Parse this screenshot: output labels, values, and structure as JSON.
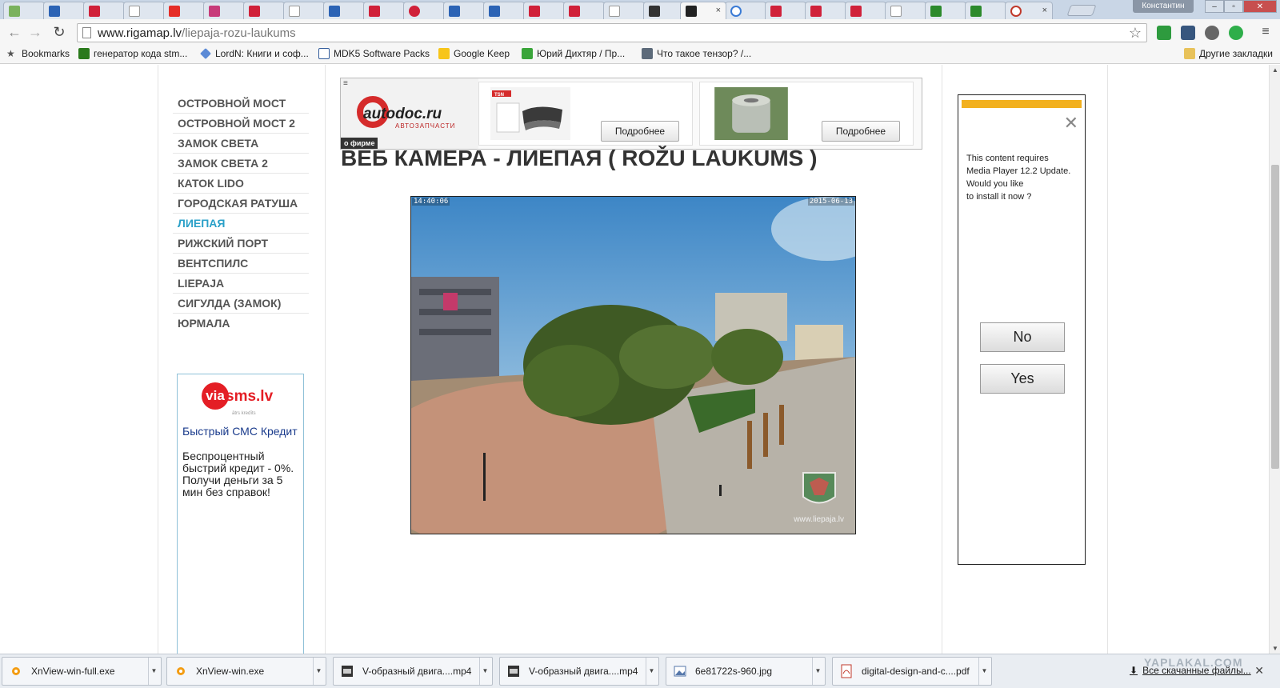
{
  "window": {
    "profile": "Константин",
    "tab_labels": [
      "",
      "",
      "",
      "",
      "",
      "",
      "",
      "",
      "",
      "",
      "",
      "",
      "",
      "",
      "",
      "",
      "",
      "",
      "",
      "",
      "",
      "",
      "",
      "",
      ""
    ],
    "active_tab_close": "×"
  },
  "toolbar": {
    "url_host": "www.rigamap.lv",
    "url_path": "/liepaja-rozu-laukums"
  },
  "bookmarks": [
    {
      "label": "Bookmarks",
      "icon": "star-icon"
    },
    {
      "label": "генератор кода stm...",
      "icon": "chip-icon"
    },
    {
      "label": "LordN: Книги и соф...",
      "icon": "blue-diamond-icon"
    },
    {
      "label": "MDK5 Software Packs",
      "icon": "keil-icon"
    },
    {
      "label": "Google Keep",
      "icon": "keep-icon"
    },
    {
      "label": "Юрий Дихтяр / Пр...",
      "icon": "green-square-icon"
    },
    {
      "label": "Что такое тензор? /...",
      "icon": "gt-icon"
    },
    {
      "label": "Другие закладки",
      "icon": "folder-icon"
    }
  ],
  "ad_banner": {
    "brand": "autodoc.ru",
    "brand_sub": "АВТОЗАПЧАСТИ",
    "about": "о фирме",
    "product1_label": "TSN",
    "button1": "Подробнее",
    "button2": "Подробнее"
  },
  "menu": [
    {
      "label": "ОСТРОВНОЙ МОСТ",
      "active": false
    },
    {
      "label": "ОСТРОВНОЙ МОСТ 2",
      "active": false
    },
    {
      "label": "ЗАМОК СВЕТА",
      "active": false
    },
    {
      "label": "ЗАМОК СВЕТА 2",
      "active": false
    },
    {
      "label": "КАТОК LIDO",
      "active": false
    },
    {
      "label": "ГОРОДСКАЯ РАТУША",
      "active": false
    },
    {
      "label": "ЛИЕПАЯ",
      "active": true
    },
    {
      "label": "РИЖСКИЙ ПОРТ",
      "active": false
    },
    {
      "label": "ВЕНТСПИЛС",
      "active": false
    },
    {
      "label": "LIEPAJA",
      "active": false
    },
    {
      "label": "СИГУЛДА (ЗАМОК)",
      "active": false
    },
    {
      "label": "ЮРМАЛА",
      "active": false
    }
  ],
  "sms_ad": {
    "logo_badge": "via",
    "logo_text": "sms.lv",
    "logo_tag": "ātrs kredīts",
    "title": "Быстрый СМС Кредит",
    "body": "Беспроцентный быстрий кредит - 0%. Получи деньги за 5 мин без справок!"
  },
  "page": {
    "title": "ВЕБ КАМЕРА - ЛИЕПАЯ ( ROŽU LAUKUMS )"
  },
  "webcam": {
    "time": "14:40:06",
    "date": "2015-06-13",
    "watermark": "www.liepaja.lv"
  },
  "popup": {
    "close": "✕",
    "message_lines": [
      "This content requires",
      "Media Player 12.2 Update.",
      "Would you like",
      "to install it now ?"
    ],
    "no": "No",
    "yes": "Yes"
  },
  "downloads": [
    {
      "name": "XnView-win-full.exe",
      "icon": "xnview-icon"
    },
    {
      "name": "XnView-win.exe",
      "icon": "xnview-icon"
    },
    {
      "name": "V-образный двига....mp4",
      "icon": "video-file-icon"
    },
    {
      "name": "V-образный двига....mp4",
      "icon": "video-file-icon"
    },
    {
      "name": "6e81722s-960.jpg",
      "icon": "image-file-icon"
    },
    {
      "name": "digital-design-and-c....pdf",
      "icon": "pdf-file-icon"
    }
  ],
  "downloads_bar": {
    "show_all": "Все скачанные файлы...",
    "watermark": "YAPLAKAL.COM"
  }
}
